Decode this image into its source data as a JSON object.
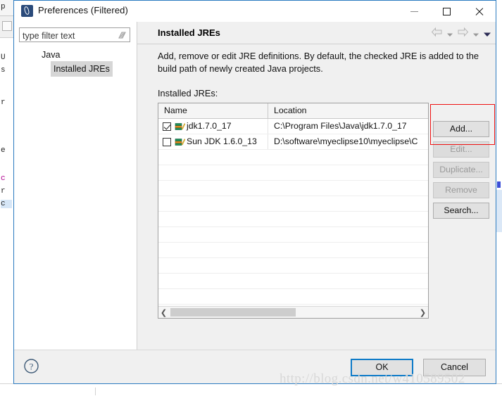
{
  "window": {
    "title": "Preferences (Filtered)",
    "icon": "eclipse-app-icon",
    "controls": {
      "minimize": "minimize-icon",
      "maximize": "maximize-icon",
      "close": "close-icon"
    }
  },
  "sidebar": {
    "filter": {
      "placeholder": "type filter text",
      "value": "",
      "clear_icon": "clear-filter-icon"
    },
    "tree": [
      {
        "label": "Java",
        "level": 1,
        "selected": false
      },
      {
        "label": "Installed JREs",
        "level": 2,
        "selected": true
      }
    ]
  },
  "pane": {
    "title": "Installed JREs",
    "description": "Add, remove or edit JRE definitions. By default, the checked JRE is added to the build path of newly created Java projects.",
    "list_label": "Installed JREs:",
    "nav": {
      "back": "back-arrow-icon",
      "back_menu": "back-dropdown-icon",
      "forward": "forward-arrow-icon",
      "forward_menu": "forward-dropdown-icon",
      "view_menu": "view-menu-icon"
    }
  },
  "table": {
    "columns": [
      "Name",
      "Location"
    ],
    "rows": [
      {
        "checked": true,
        "icon": "jre-icon",
        "name": "jdk1.7.0_17",
        "location": "C:\\Program Files\\Java\\jdk1.7.0_17"
      },
      {
        "checked": false,
        "icon": "jre-icon",
        "name": "Sun JDK 1.6.0_13",
        "location": "D:\\software\\myeclipse10\\myeclipse\\C"
      }
    ],
    "empty_rows": 11,
    "scrollbar": {
      "left_arrow": "❮",
      "right_arrow": "❯"
    }
  },
  "side_buttons": [
    {
      "label": "Add...",
      "enabled": true,
      "highlighted": true
    },
    {
      "label": "Edit...",
      "enabled": false,
      "highlighted": false
    },
    {
      "label": "Duplicate...",
      "enabled": false,
      "highlighted": false
    },
    {
      "label": "Remove",
      "enabled": false,
      "highlighted": false
    },
    {
      "label": "Search...",
      "enabled": true,
      "highlighted": false
    }
  ],
  "footer": {
    "help_icon": "help-icon",
    "ok_label": "OK",
    "cancel_label": "Cancel"
  },
  "watermark": "http://blog.csdn.net/w410589502",
  "background": {
    "fragments": [
      "p",
      "",
      "U",
      "s",
      "r",
      "e",
      "c",
      "r",
      "c"
    ]
  },
  "colors": {
    "accent": "#0d7ac8",
    "dialog_border": "#2a7ac0",
    "highlight_red": "#ee1111",
    "panel_bg": "#f0f0f0",
    "selection_gray": "#d6d6d6"
  }
}
